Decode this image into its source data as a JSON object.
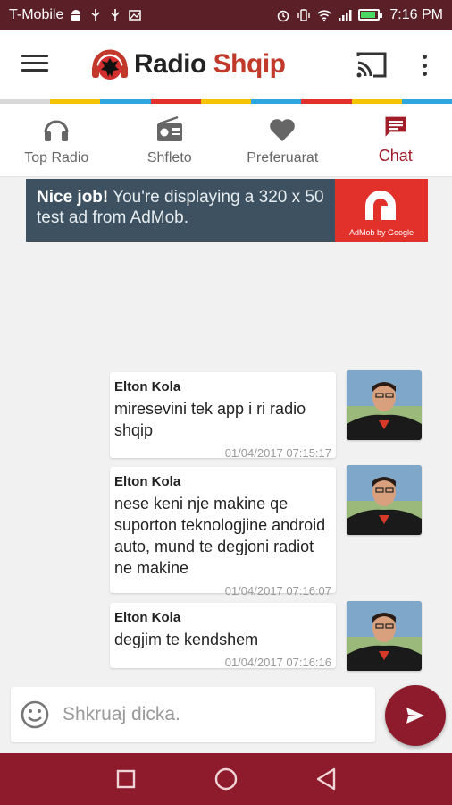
{
  "status_bar": {
    "carrier": "T-Mobile",
    "time": "7:16 PM",
    "background": "#5a1f27"
  },
  "toolbar": {
    "logo_text_main": "Radio ",
    "logo_text_accent": "Shqip",
    "accent_color": "#c0392b",
    "stripe_colors": [
      "#d9d9d9",
      "#f5c400",
      "#2ea7e0",
      "#e2302a",
      "#f5c400",
      "#2ea7e0",
      "#e2302a",
      "#f5c400",
      "#2ea7e0"
    ]
  },
  "tabs": [
    {
      "label": "Top Radio",
      "icon": "headphones-icon",
      "active": false
    },
    {
      "label": "Shfleto",
      "icon": "radio-icon",
      "active": false
    },
    {
      "label": "Preferuarat",
      "icon": "heart-icon",
      "active": false
    },
    {
      "label": "Chat",
      "icon": "chat-icon",
      "active": true
    }
  ],
  "ad": {
    "headline": "Nice job!",
    "body": " You're displaying a 320 x 50 test ad from AdMob.",
    "brand_caption": "AdMob by Google"
  },
  "messages": [
    {
      "author": "Elton Kola",
      "text": "miresevini tek app i ri radio shqip",
      "time": "01/04/2017 07:15:17"
    },
    {
      "author": "Elton Kola",
      "text": "nese keni nje makine qe suporton teknologjine android auto, mund te degjoni radiot ne makine",
      "time": "01/04/2017 07:16:07"
    },
    {
      "author": "Elton Kola",
      "text": "degjim te kendshem",
      "time": "01/04/2017 07:16:16"
    }
  ],
  "composer": {
    "placeholder": "Shkruaj dicka.",
    "value": ""
  },
  "theme": {
    "primary": "#8e1b2b",
    "chat_background": "#f1f1f1"
  }
}
